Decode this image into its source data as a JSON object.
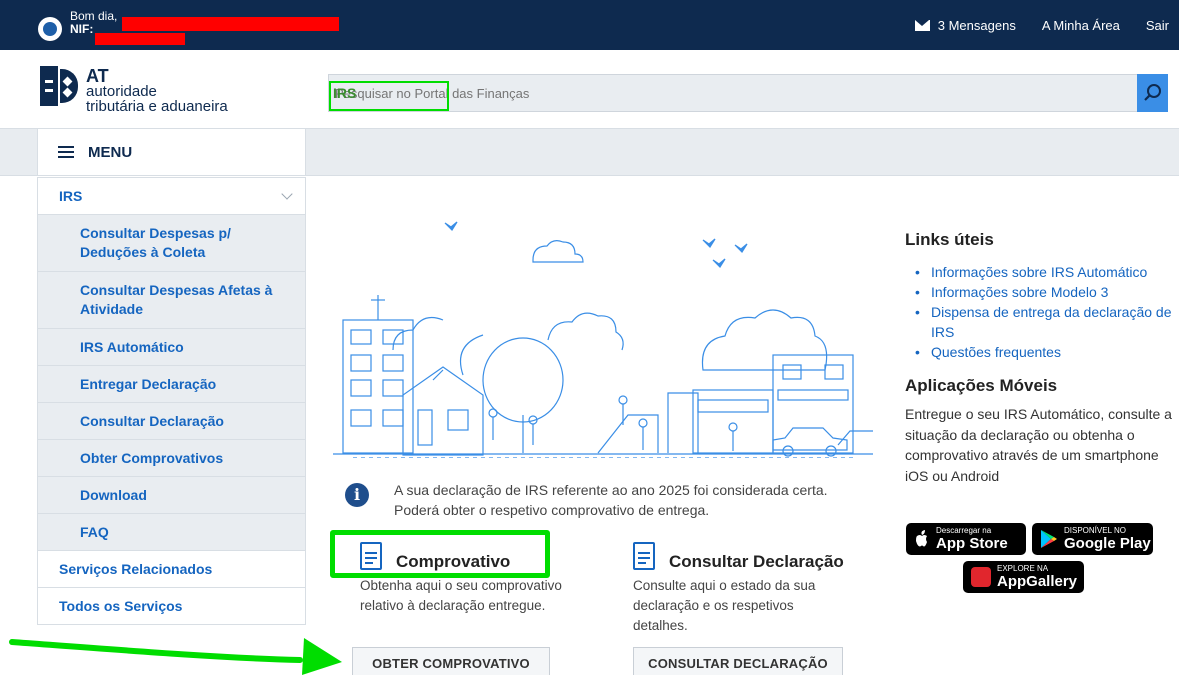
{
  "topbar": {
    "greeting": "Bom dia,",
    "nif_label": "NIF:",
    "messages": "3 Mensagens",
    "my_area": "A Minha Área",
    "logout": "Sair"
  },
  "logo": {
    "abbr": "AT",
    "line1": "autoridade",
    "line2": "tributária e aduaneira"
  },
  "search": {
    "value": "IRS",
    "placeholder": "Pesquisar no Portal das Finanças"
  },
  "menu": {
    "label": "MENU",
    "items": [
      {
        "label": "IRS"
      },
      {
        "label": "Consultar Despesas p/ Deduções à Coleta"
      },
      {
        "label": "Consultar Despesas Afetas à Atividade"
      },
      {
        "label": "IRS Automático"
      },
      {
        "label": "Entregar Declaração"
      },
      {
        "label": "Consultar Declaração"
      },
      {
        "label": "Obter Comprovativos"
      },
      {
        "label": "Download"
      },
      {
        "label": "FAQ"
      },
      {
        "label": "Serviços Relacionados"
      },
      {
        "label": "Todos os Serviços"
      }
    ]
  },
  "notice": {
    "text": "A sua declaração de IRS referente ao ano 2025 foi considerada certa. Poderá obter o respetivo comprovativo de entrega."
  },
  "cards": [
    {
      "title": "Comprovativo",
      "desc": "Obtenha aqui o seu comprovativo relativo à declaração entregue.",
      "button": "OBTER COMPROVATIVO"
    },
    {
      "title": "Consultar Declaração",
      "desc": "Consulte aqui o estado da sua declaração e os respetivos detalhes.",
      "button": "CONSULTAR DECLARAÇÃO"
    }
  ],
  "useful_links": {
    "title": "Links úteis",
    "items": [
      "Informações sobre IRS Automático",
      "Informações sobre Modelo 3",
      "Dispensa de entrega da declaração de IRS",
      "Questões frequentes"
    ]
  },
  "mobile_apps": {
    "title": "Aplicações Móveis",
    "desc": "Entregue o seu IRS Automático, consulte a situação da declaração ou obtenha o comprovativo através de um smartphone iOS ou Android",
    "stores": [
      {
        "small": "Descarregar na",
        "big": "App Store"
      },
      {
        "small": "DISPONÍVEL NO",
        "big": "Google Play"
      },
      {
        "small": "EXPLORE NA",
        "big": "AppGallery"
      }
    ]
  },
  "colors": {
    "topbar": "#0e2a4f",
    "link": "#1565c0",
    "highlight": "#00dd00",
    "illustration": "#3a8ee6"
  }
}
